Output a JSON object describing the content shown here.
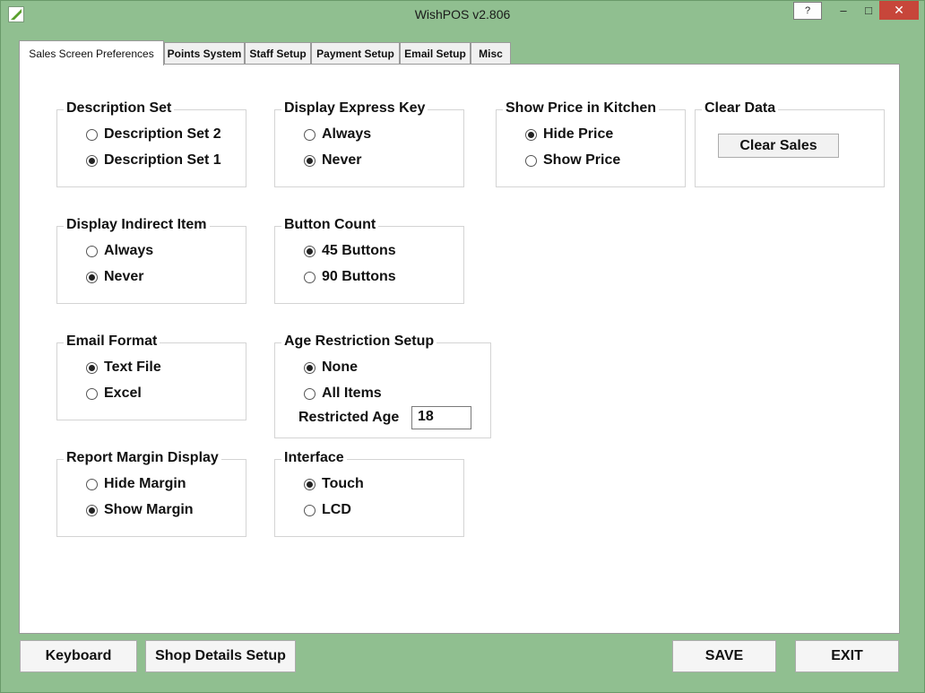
{
  "window": {
    "title": "WishPOS v2.806",
    "help_label": "?",
    "minimize_label": "–",
    "maximize_label": "□",
    "close_label": "✕"
  },
  "tabs": [
    {
      "label": "Sales Screen Preferences"
    },
    {
      "label": "Points System"
    },
    {
      "label": "Staff Setup"
    },
    {
      "label": "Payment Setup"
    },
    {
      "label": "Email Setup"
    },
    {
      "label": "Misc"
    }
  ],
  "groups": {
    "description_set": {
      "title": "Description Set",
      "options": [
        "Description Set 2",
        "Description Set 1"
      ],
      "selected": 1
    },
    "display_express_key": {
      "title": "Display Express Key",
      "options": [
        "Always",
        "Never"
      ],
      "selected": 1
    },
    "show_price_kitchen": {
      "title": "Show Price in Kitchen",
      "options": [
        "Hide Price",
        "Show Price"
      ],
      "selected": 0
    },
    "clear_data": {
      "title": "Clear Data",
      "button_label": "Clear Sales"
    },
    "display_indirect_item": {
      "title": "Display Indirect Item",
      "options": [
        "Always",
        "Never"
      ],
      "selected": 1
    },
    "button_count": {
      "title": "Button Count",
      "options": [
        "45 Buttons",
        "90 Buttons"
      ],
      "selected": 0
    },
    "email_format": {
      "title": "Email Format",
      "options": [
        "Text File",
        "Excel"
      ],
      "selected": 0
    },
    "age_restriction": {
      "title": "Age Restriction Setup",
      "options": [
        "None",
        "All Items"
      ],
      "selected": 0,
      "restricted_age_label": "Restricted Age",
      "restricted_age_value": "18"
    },
    "report_margin": {
      "title": "Report Margin Display",
      "options": [
        "Hide Margin",
        "Show Margin"
      ],
      "selected": 1
    },
    "interface": {
      "title": "Interface",
      "options": [
        "Touch",
        "LCD"
      ],
      "selected": 0
    }
  },
  "footer": {
    "keyboard_label": "Keyboard",
    "shop_details_label": "Shop Details Setup",
    "save_label": "SAVE",
    "exit_label": "EXIT"
  }
}
